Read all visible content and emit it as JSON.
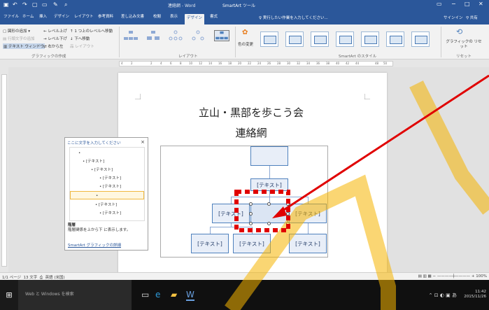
{
  "titlebar": {
    "doc_title": "連絡網 - Word",
    "context_tab": "SmartArt ツール",
    "save_icon": "save-icon",
    "undo_icon": "undo-icon",
    "redo_icon": "redo-icon"
  },
  "tabs": [
    {
      "label": "ファイル"
    },
    {
      "label": "ホーム"
    },
    {
      "label": "挿入"
    },
    {
      "label": "デザイン"
    },
    {
      "label": "レイアウト"
    },
    {
      "label": "参考資料"
    },
    {
      "label": "差し込み文書"
    },
    {
      "label": "校閲"
    },
    {
      "label": "表示"
    },
    {
      "label": "デザイン",
      "active": true
    },
    {
      "label": "書式"
    }
  ],
  "tell_me": "実行したい作業を入力してください...",
  "signin": "サインイン",
  "share": "共有",
  "ribbon": {
    "create": {
      "add_shape": "図形の追加",
      "text_pane_disabled": "行頭文字の追加",
      "text_pane": "テキスト ウィンドウ",
      "promote": "レベル上げ",
      "demote": "レベル下げ",
      "move_up": "1 つ上のレベルへ移動",
      "move_down": "下へ移動",
      "rtl": "右から左",
      "layout_btn": "レイアウト",
      "group": "グラフィックの作成"
    },
    "layouts_group": "レイアウト",
    "change_colors": "色の変更",
    "styles_group": "SmartArt のスタイル",
    "reset_graphic": "グラフィックの リセット",
    "reset_group": "リセット"
  },
  "ruler": {
    "labels": [
      "4",
      "2",
      "",
      "2",
      "4",
      "6",
      "8",
      "10",
      "12",
      "14",
      "16",
      "18",
      "20",
      "22",
      "24",
      "26",
      "28",
      "30",
      "32",
      "34",
      "36",
      "38",
      "40",
      "42",
      "44",
      "",
      "48",
      "50"
    ]
  },
  "doc": {
    "title1": "立山・黒部を歩こう会",
    "title2": "連絡網"
  },
  "smartart": {
    "box_text": "[テキスト]"
  },
  "text_pane": {
    "header": "ここに文字を入力してください",
    "close": "×",
    "items": [
      {
        "text": "•",
        "level": 0
      },
      {
        "text": "• [テキスト]",
        "level": 1
      },
      {
        "text": "• [テキスト]",
        "level": 2
      },
      {
        "text": "• [テキスト]",
        "level": 3
      },
      {
        "text": "• [テキスト]",
        "level": 3
      },
      {
        "text": "•",
        "level": 2,
        "selected": true
      },
      {
        "text": "• [テキスト]",
        "level": 2
      },
      {
        "text": "• [テキスト]",
        "level": 3
      }
    ],
    "desc_title": "階層",
    "desc_body": "階層関係を上から下 に表示します。",
    "link": "SmartArt グラフィックの詳細"
  },
  "statusbar": {
    "page": "1/1 ページ",
    "words": "13 文字",
    "lang": "英語 (米国)",
    "zoom": "100%"
  },
  "taskbar": {
    "search": "Web と Windows を検索",
    "time": "11:42",
    "date": "2015/11/26"
  },
  "colors": {
    "word_blue": "#2b579a",
    "smartart_border": "#4f81bd",
    "highlight_red": "#e00000",
    "arrow_red": "#e00000",
    "watermark": "#f5b400"
  }
}
